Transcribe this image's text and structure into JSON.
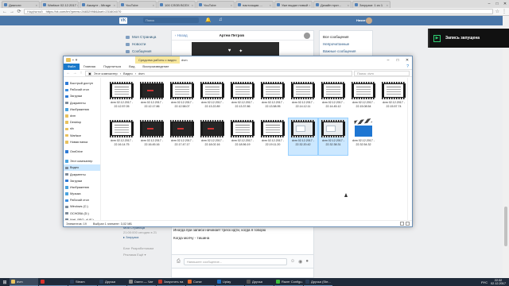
{
  "browser": {
    "tabs": [
      {
        "label": "Диалоги",
        "active": false
      },
      {
        "label": "Warface 02.12.2017",
        "active": false
      },
      {
        "label": "Аккаунт - Mirage",
        "active": false
      },
      {
        "label": "YouTube",
        "active": false
      },
      {
        "label": "100 СЛОВ ВСЕХ",
        "active": false
      },
      {
        "label": "YouTube",
        "active": false
      },
      {
        "label": "настоящая ...",
        "active": false
      },
      {
        "label": "Уже выдал новый",
        "active": false
      },
      {
        "label": "Дизайн прот...",
        "active": false
      },
      {
        "label": "Загрузки: 1 из 1",
        "active": false
      }
    ],
    "security": "Надёжный",
    "url": "https://vk.com/im?peers=268329984&sel=231604070"
  },
  "vk": {
    "logo": "VK",
    "search_placeholder": "Поиск",
    "user_name": "Никита",
    "left_menu": [
      "Моя Страница",
      "Новости",
      "Сообщения"
    ],
    "chat": {
      "back": "‹ Назад",
      "contact": "Артем Петров",
      "meta": "Никита  21:56",
      "messages": [
        "дам - 0ещё",
        "Иногда при записи начинает треск идти, когда я говорю",
        "Когда молчу - тишина"
      ],
      "input_placeholder": "Напишите сообщение..."
    },
    "right_menu": [
      "Все сообщения",
      "Непрочитанные",
      "Важные сообщения",
      "",
      "",
      "",
      ""
    ],
    "left_lower": [
      "Моя Страница",
      "21:00:000 сегодня в 21",
      "▸ Загрузка",
      "Блог  Разработчикам",
      "Реклама  Ещё ▾"
    ]
  },
  "recording": {
    "label": "Запись запущена"
  },
  "explorer": {
    "context_tab": "Средства работы с видео",
    "title": "dvm",
    "ribbon": [
      "Файл",
      "Главная",
      "Поделиться",
      "Вид",
      "Воспроизведение"
    ],
    "path": [
      "Этот компьютер",
      "Видео",
      "dvm"
    ],
    "search_placeholder": "Поиск: dvm",
    "nav": [
      {
        "label": "Быстрый доступ",
        "color": "#2d7ad6",
        "sel": false
      },
      {
        "label": "Рабочий стол",
        "color": "#3a8de0",
        "sel": false
      },
      {
        "label": "Загрузки",
        "color": "#2d7ad6",
        "sel": false
      },
      {
        "label": "Документы",
        "color": "#7c8a99",
        "sel": false
      },
      {
        "label": "Изображения",
        "color": "#4aa3df",
        "sel": false
      },
      {
        "label": "dvm",
        "color": "#e8c25e",
        "sel": false
      },
      {
        "label": "Desktop",
        "color": "#e8c25e",
        "sel": false
      },
      {
        "label": "sfx",
        "color": "#e8c25e",
        "sel": false
      },
      {
        "label": "Warface",
        "color": "#e8c25e",
        "sel": false
      },
      {
        "label": "Новая папка",
        "color": "#e8c25e",
        "sel": false
      },
      {
        "label": "",
        "color": "",
        "sel": false,
        "gap": true
      },
      {
        "label": "OneDrive",
        "color": "#2d7ad6",
        "sel": false
      },
      {
        "label": "",
        "color": "",
        "sel": false,
        "gap": true
      },
      {
        "label": "Этот компьютер",
        "color": "#4aa3df",
        "sel": false
      },
      {
        "label": "Видео",
        "color": "#7c8a99",
        "sel": true
      },
      {
        "label": "Документы",
        "color": "#7c8a99",
        "sel": false
      },
      {
        "label": "Загрузки",
        "color": "#2d7ad6",
        "sel": false
      },
      {
        "label": "Изображения",
        "color": "#4aa3df",
        "sel": false
      },
      {
        "label": "Музыка",
        "color": "#4aa3df",
        "sel": false
      },
      {
        "label": "Рабочий стол",
        "color": "#3a8de0",
        "sel": false
      },
      {
        "label": "Windows (C:)",
        "color": "#7c8a99",
        "sel": false
      },
      {
        "label": "ОСНОВА (D:)",
        "color": "#7c8a99",
        "sel": false
      },
      {
        "label": "Wall_PRO_dl (E:)",
        "color": "#7c8a99",
        "sel": false
      }
    ],
    "files": [
      {
        "name": "dvm 02.12.2017 -",
        "time": "22.12.57.05",
        "kind": "film",
        "style": "doc",
        "sel": false
      },
      {
        "name": "dvm 02.12.2017 -",
        "time": "22.12.17.86",
        "kind": "film",
        "style": "dark",
        "sel": false
      },
      {
        "name": "dvm 02.12.2017 -",
        "time": "22.12.58.07",
        "kind": "film",
        "style": "doc",
        "sel": false
      },
      {
        "name": "dvm 02.12.2017 -",
        "time": "22.13.22.89",
        "kind": "film",
        "style": "doc",
        "sel": false
      },
      {
        "name": "dvm 02.12.2017 -",
        "time": "22.13.37.86",
        "kind": "film",
        "style": "doc",
        "sel": false
      },
      {
        "name": "dvm 02.12.2017 -",
        "time": "22.13.58.95",
        "kind": "film",
        "style": "doc",
        "sel": false
      },
      {
        "name": "dvm 02.12.2017 -",
        "time": "22.14.12.11",
        "kind": "film",
        "style": "doc",
        "sel": false
      },
      {
        "name": "dvm 02.12.2017 -",
        "time": "22.14.45.12",
        "kind": "film",
        "style": "doc",
        "sel": false
      },
      {
        "name": "dvm 02.12.2017 -",
        "time": "22.15.08.54",
        "kind": "film",
        "style": "doc",
        "sel": false
      },
      {
        "name": "dvm 02.12.2017 -",
        "time": "22.15.57.74",
        "kind": "film",
        "style": "doc",
        "sel": false
      },
      {
        "name": "dvm 02.12.2017 -",
        "time": "22.16.14.75",
        "kind": "film",
        "style": "doc",
        "sel": false
      },
      {
        "name": "dvm 02.12.2017 -",
        "time": "22.16.45.16",
        "kind": "film",
        "style": "dark",
        "sel": false
      },
      {
        "name": "dvm 02.12.2017 -",
        "time": "22.17.47.17",
        "kind": "film",
        "style": "dark",
        "sel": false
      },
      {
        "name": "dvm 02.12.2017 -",
        "time": "22.18.02.16",
        "kind": "film",
        "style": "dark",
        "sel": false
      },
      {
        "name": "dvm 02.12.2017 -",
        "time": "22.18.56.19",
        "kind": "film",
        "style": "doc",
        "sel": false
      },
      {
        "name": "dvm 02.12.2017 -",
        "time": "22.19.11.20",
        "kind": "film",
        "style": "doc",
        "sel": false
      },
      {
        "name": "dvm 02.12.2017 -",
        "time": "22.32.20.42",
        "kind": "film",
        "style": "ui",
        "sel": true
      },
      {
        "name": "dvm 02.12.2017 -",
        "time": "22.32.38.31",
        "kind": "film",
        "style": "ui",
        "sel": true
      },
      {
        "name": "dvm 02.12.2017 -",
        "time": "22.32.54.32",
        "kind": "clap",
        "style": "",
        "sel": false
      }
    ],
    "status": {
      "items": "Элементов: 19",
      "selected": "Выбран 1 элемент: 3,02 МБ"
    }
  },
  "taskbar": {
    "apps": [
      {
        "label": "dvm",
        "color": "#e8c25e",
        "active": true
      },
      {
        "label": "",
        "color": "#d9302c",
        "active": false
      },
      {
        "label": "Steam",
        "color": "#2a3f5a",
        "active": false
      },
      {
        "label": "Друзья",
        "color": "#2a3f5a",
        "active": false
      },
      {
        "label": "Damn — Чат",
        "color": "#888",
        "active": false
      },
      {
        "label": "Запустить на",
        "color": "#c0392b",
        "active": false
      },
      {
        "label": "Curse",
        "color": "#e0672b",
        "active": false
      },
      {
        "label": "Uplay",
        "color": "#1c6fc3",
        "active": false
      },
      {
        "label": "Друзья",
        "color": "#555",
        "active": false
      },
      {
        "label": "Razer Configu...",
        "color": "#3cbf3c",
        "active": false
      },
      {
        "label": "Друзья (Ste...",
        "color": "#2a3f5a",
        "active": false
      }
    ],
    "lang": "РУС",
    "time": "22:32",
    "date": "02.12.2017"
  }
}
